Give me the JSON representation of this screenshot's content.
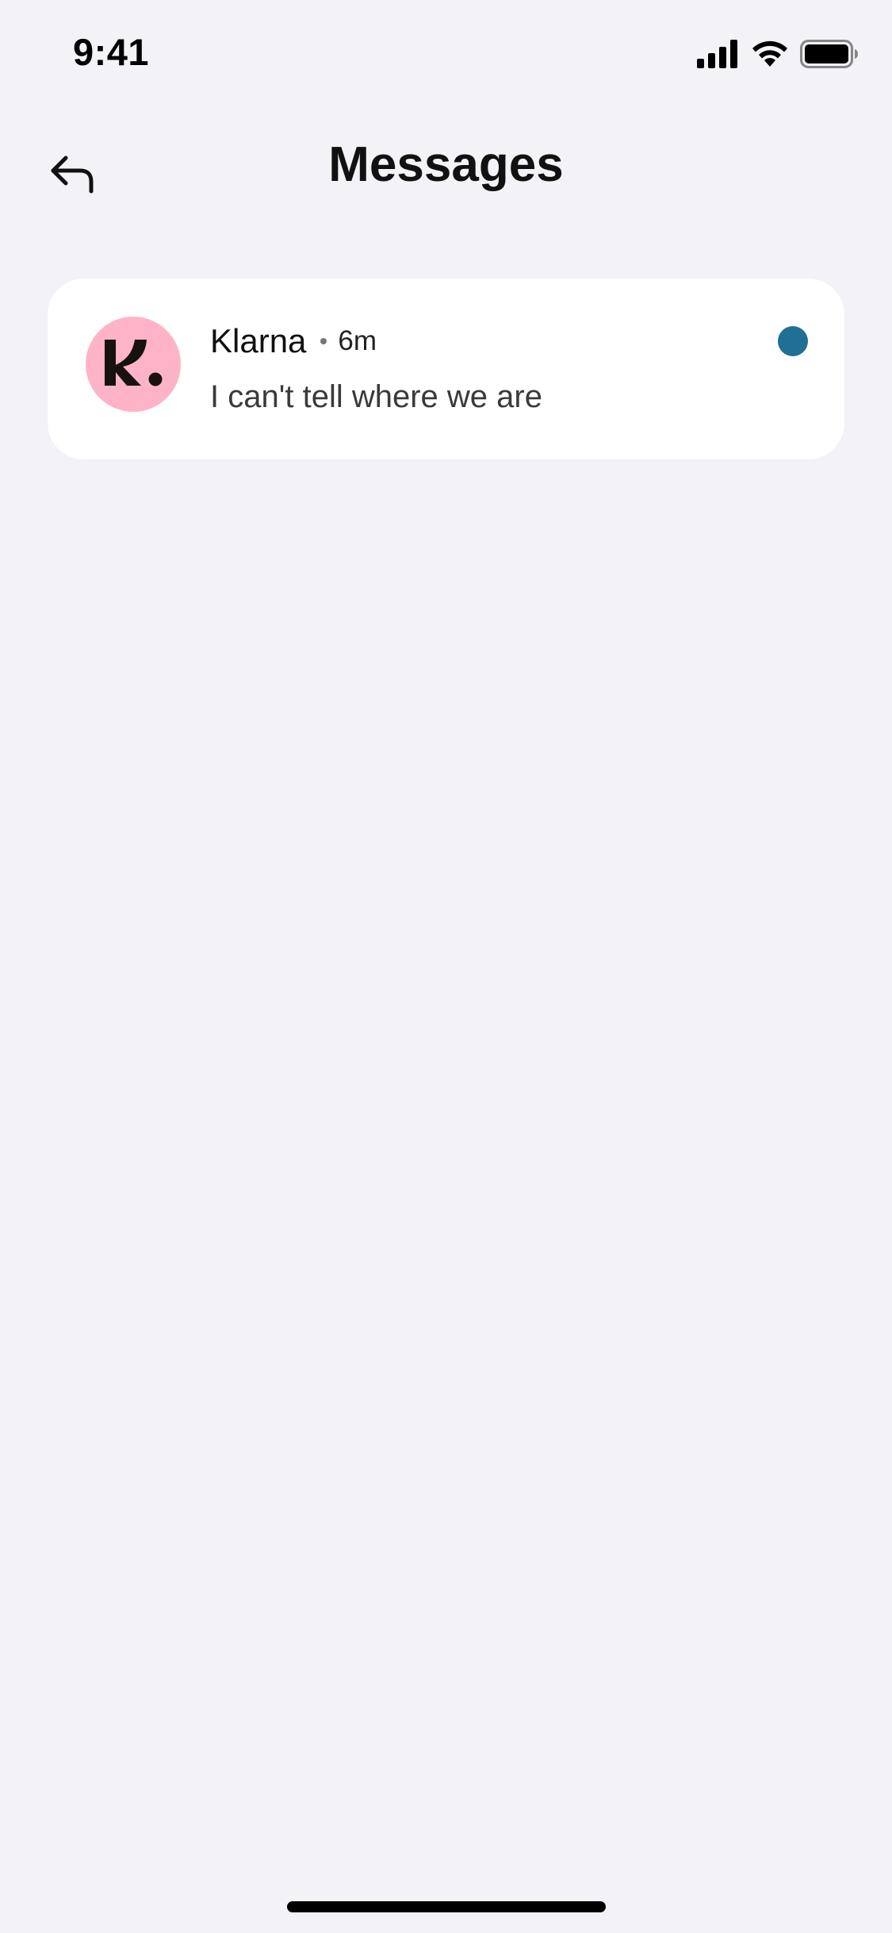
{
  "status_bar": {
    "time": "9:41",
    "icons": [
      "cellular-signal-icon",
      "wifi-icon",
      "battery-icon"
    ]
  },
  "header": {
    "title": "Messages",
    "back_icon": "back-arrow-icon"
  },
  "messages": [
    {
      "sender": "Klarna",
      "time_ago": "6m",
      "preview": "I can't tell where we are",
      "avatar_letter": "K.",
      "avatar_color": "#ffb3c7",
      "unread": true,
      "unread_color": "#1f7094"
    }
  ],
  "colors": {
    "background": "#f2f2f7",
    "card": "#ffffff",
    "text_primary": "#111111",
    "text_secondary": "#3a3a3c"
  }
}
